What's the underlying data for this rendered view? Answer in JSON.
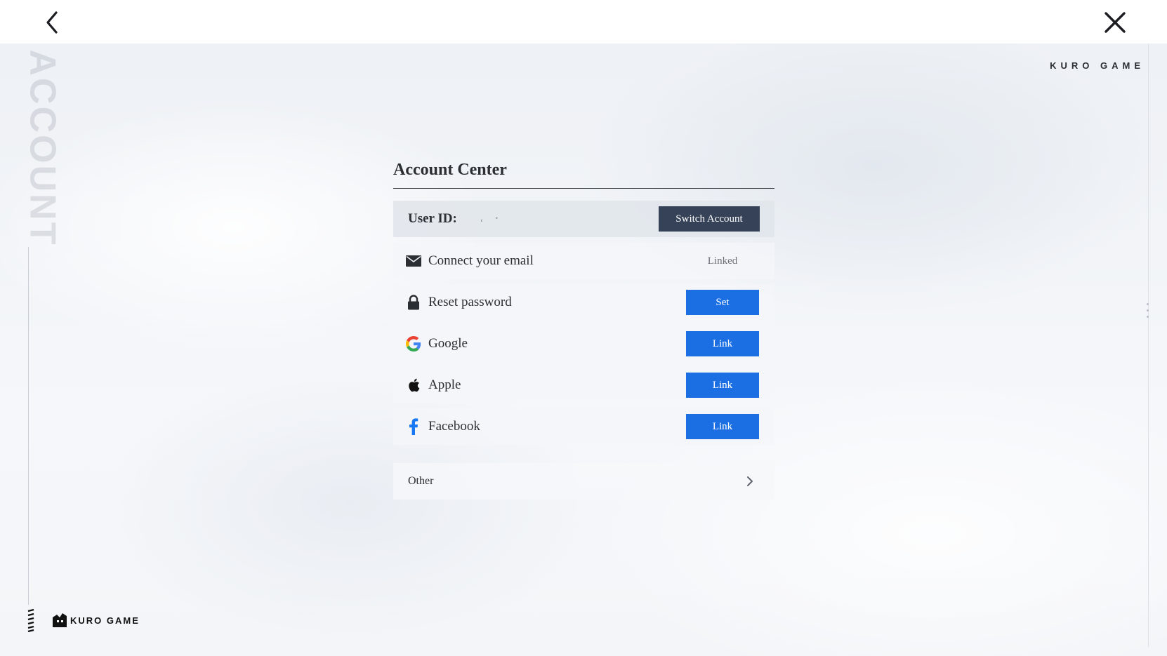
{
  "header": {
    "back_icon": "chevron-left-icon",
    "close_icon": "close-icon"
  },
  "side": {
    "watermark": "ACCOUNT"
  },
  "brand": {
    "top_text": "KURO GAME",
    "bottom_text": "KURO GAME"
  },
  "account_center": {
    "title": "Account Center",
    "user_id_label": "User ID:",
    "user_id_value": "ᵣ ᶜ",
    "switch_account_label": "Switch Account",
    "rows": [
      {
        "icon": "mail-icon",
        "label": "Connect your email",
        "status": "Linked"
      },
      {
        "icon": "lock-icon",
        "label": "Reset password",
        "action": "Set"
      },
      {
        "icon": "google-icon",
        "label": "Google",
        "action": "Link"
      },
      {
        "icon": "apple-icon",
        "label": "Apple",
        "action": "Link"
      },
      {
        "icon": "facebook-icon",
        "label": "Facebook",
        "action": "Link"
      }
    ],
    "other_label": "Other"
  },
  "colors": {
    "primary_button": "#1c6fe3",
    "switch_button": "#364258",
    "google_blue": "#4285F4",
    "google_red": "#EA4335",
    "google_yellow": "#FBBC05",
    "google_green": "#34A853",
    "facebook_blue": "#1877F2"
  }
}
